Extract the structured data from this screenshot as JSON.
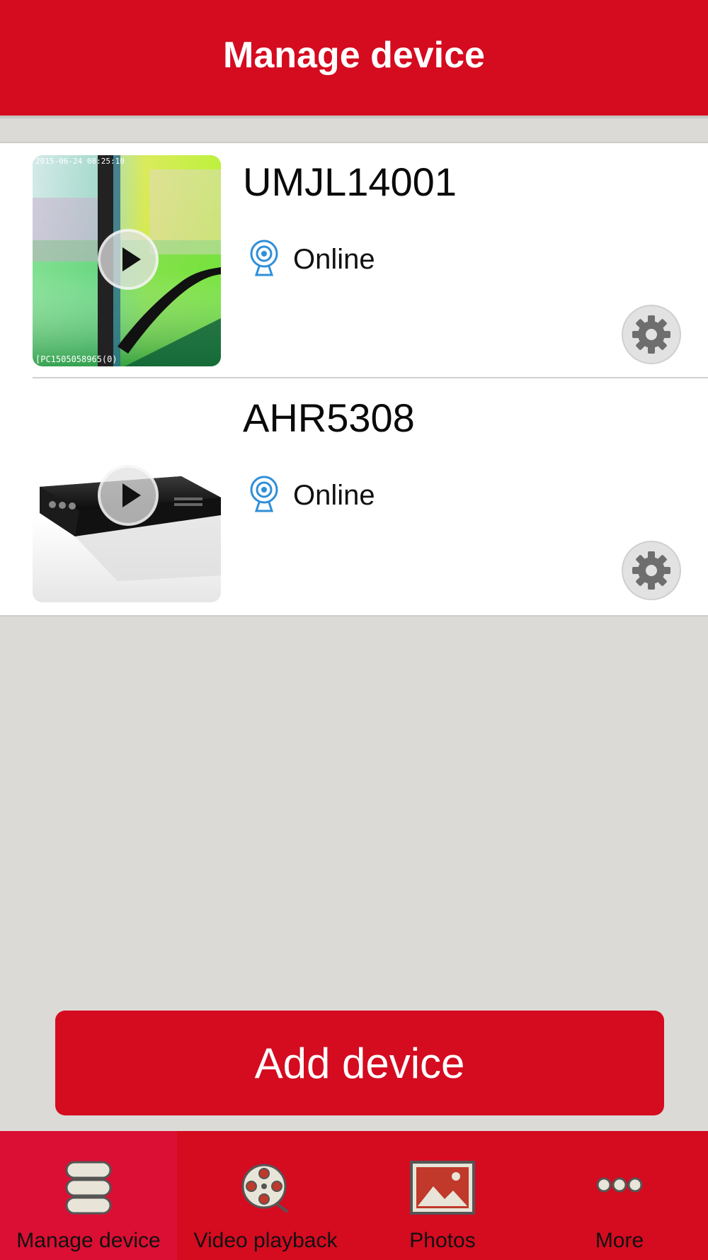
{
  "header": {
    "title": "Manage device"
  },
  "devices": [
    {
      "name": "UMJL14001",
      "status": "Online",
      "thumb_timestamp": "2015-06-24 08:25:10",
      "thumb_caption": "[PC1505058965(0)"
    },
    {
      "name": "AHR5308",
      "status": "Online"
    }
  ],
  "add_button": {
    "label": "Add device"
  },
  "tabs": [
    {
      "label": "Manage device",
      "icon": "stack-icon",
      "active": true
    },
    {
      "label": "Video playback",
      "icon": "film-reel-icon",
      "active": false
    },
    {
      "label": "Photos",
      "icon": "picture-icon",
      "active": false
    },
    {
      "label": "More",
      "icon": "more-dots-icon",
      "active": false
    }
  ],
  "colors": {
    "brand_red": "#d50b20",
    "background": "#dcdad6",
    "accent_blue": "#2f8fd8"
  }
}
